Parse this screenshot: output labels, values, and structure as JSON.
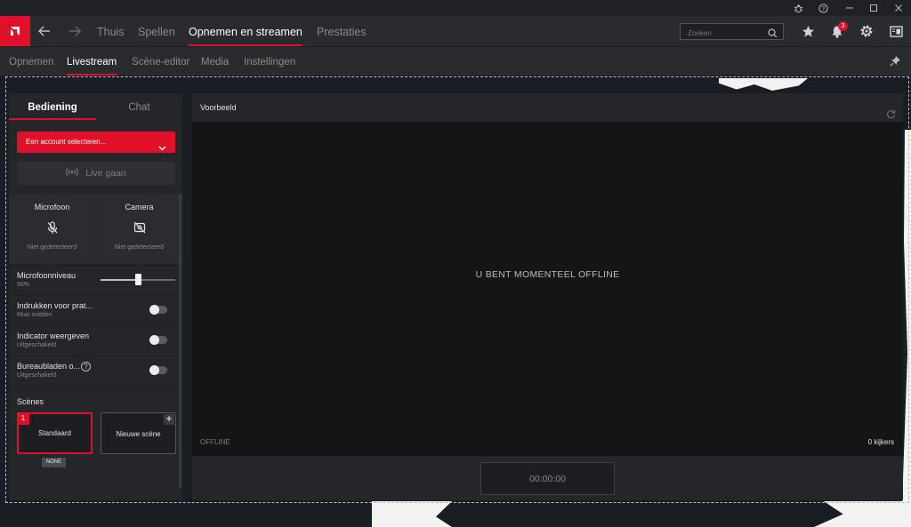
{
  "nav": {
    "items": [
      "Thuis",
      "Spellen",
      "Opnemen en streamen",
      "Prestaties"
    ],
    "search_placeholder": "Zoeken",
    "notification_count": "3"
  },
  "subnav": {
    "items": [
      "Opnemen",
      "Livestream",
      "Scène-editor",
      "Media",
      "Instellingen"
    ]
  },
  "left": {
    "tabs": [
      "Bediening",
      "Chat"
    ],
    "account_label": "Een account selecteren...",
    "go_live": "Live gaan",
    "devices": [
      {
        "title": "Microfoon",
        "status": "Niet gedetecteerd",
        "icon": "microphone-off-icon"
      },
      {
        "title": "Camera",
        "status": "Niet gedetecteerd",
        "icon": "camera-off-icon"
      }
    ],
    "mic_level": {
      "label": "Microfoonniveau",
      "value": "50%",
      "fraction": 0.5
    },
    "push_to_talk": {
      "label": "Indrukken voor prat...",
      "sub": "Muis midden"
    },
    "indicator": {
      "label": "Indicator weergeven",
      "sub": "Uitgeschakeld"
    },
    "desktop": {
      "label": "Bureaubladen o...",
      "sub": "Uitgeschakeld"
    },
    "scenes_title": "Scènes",
    "scenes": [
      {
        "number": "1",
        "name": "Standaard"
      },
      {
        "name": "Nieuwe scène"
      }
    ],
    "scene_badge": "NONE"
  },
  "preview": {
    "title": "Voorbeeld",
    "message": "U BENT MOMENTEEL OFFLINE",
    "status": "OFFLINE",
    "viewers": "0 kijkers",
    "timer": "00:00:00"
  },
  "colors": {
    "accent": "#e0102a",
    "background": "#1c1d20",
    "panel": "#252629"
  }
}
